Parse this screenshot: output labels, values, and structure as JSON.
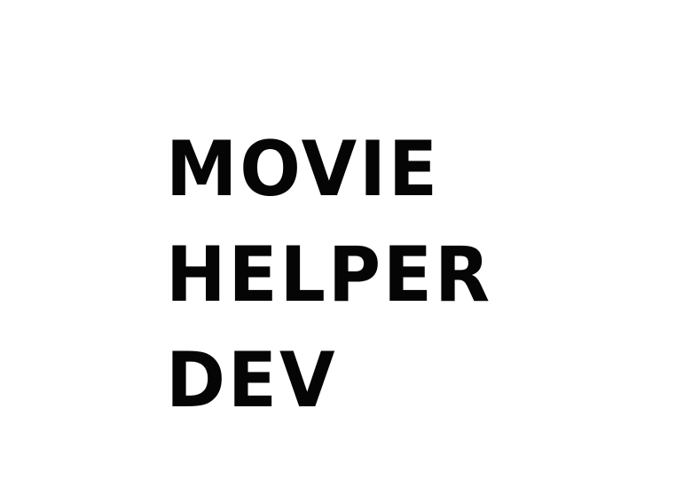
{
  "splash": {
    "title_lines": [
      "MOVIE",
      "HELPER",
      "DEV"
    ]
  },
  "colors": {
    "background": "#ffffff",
    "text": "#050505"
  }
}
